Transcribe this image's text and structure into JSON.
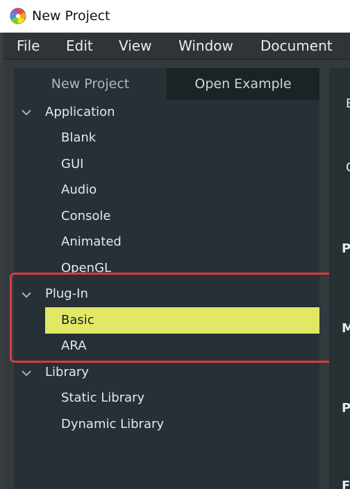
{
  "window": {
    "title": "New Project"
  },
  "menu": [
    "File",
    "Edit",
    "View",
    "Window",
    "Document"
  ],
  "tabs": {
    "new_project": "New Project",
    "open_example": "Open Example"
  },
  "tree": {
    "application": {
      "label": "Application",
      "children": [
        "Blank",
        "GUI",
        "Audio",
        "Console",
        "Animated",
        "OpenGL"
      ]
    },
    "plugin": {
      "label": "Plug-In",
      "children": [
        "Basic",
        "ARA"
      ],
      "selected": "Basic"
    },
    "library": {
      "label": "Library",
      "children": [
        "Static Library",
        "Dynamic Library"
      ]
    }
  },
  "right_panel_letters": [
    "B",
    "C",
    "P",
    "M",
    "P",
    "F"
  ],
  "colors": {
    "selection": "#e1e866",
    "highlight_border": "#dc3a40",
    "panel_bg": "#263035"
  }
}
